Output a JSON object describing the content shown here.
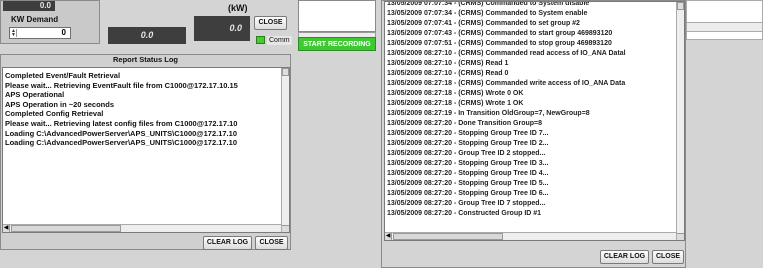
{
  "kw_panel": {
    "top_value": "0.0",
    "label": "KW Demand",
    "input_value": "0"
  },
  "power_panel": {
    "unit_label": "(kW)",
    "left_value": "0.0",
    "right_value": "0.0",
    "close_label": "CLOSE",
    "comm_label": "Comm"
  },
  "start_recording_label": "START RECORDING",
  "report_log": {
    "title": "Report Status Log",
    "lines": [
      "Completed Event/Fault Retrieval",
      "Please wait... Retrieving EventFault file from C1000@172.17.10.15",
      "APS Operational",
      "APS Operation in ~20 seconds",
      "Completed Config Retrieval",
      "Please wait... Retrieving latest config files from C1000@172.17.10",
      "Loading C:\\AdvancedPowerServer\\APS_UNITS\\C1000@172.17.10",
      "Loading C:\\AdvancedPowerServer\\APS_UNITS\\C1000@172.17.10"
    ],
    "clear_label": "CLEAR LOG",
    "close_label": "CLOSE"
  },
  "command_log": {
    "lines": [
      "13/05/2009 07:07:34 - (CRMS) Commanded to System disable",
      "13/05/2009 07:07:34 - (CRMS) Commanded to System enable",
      "13/05/2009 07:07:41 - (CRMS) Commanded to set group #2",
      "13/05/2009 07:07:43 - (CRMS) Commanded to start group 469893120",
      "13/05/2009 07:07:51 - (CRMS) Commanded to stop group 469893120",
      "13/05/2009 08:27:10 - (CRMS) Commanded read access of IO_ANA Datal",
      "13/05/2009 08:27:10 - (CRMS) Read 1",
      "13/05/2009 08:27:10 - (CRMS) Read 0",
      "13/05/2009 08:27:18 - (CRMS) Commanded write access of IO_ANA Data",
      "13/05/2009 08:27:18 - (CRMS) Wrote 0 OK",
      "13/05/2009 08:27:18 - (CRMS) Wrote 1 OK",
      "13/05/2009 08:27:19 - In Transition OldGroup=7, NewGroup=8",
      "13/05/2009 08:27:20 - Done Transition Group=8",
      "13/05/2009 08:27:20 - Stopping Group Tree ID 7...",
      "13/05/2009 08:27:20 - Stopping Group Tree ID 2...",
      "13/05/2009 08:27:20 - Group Tree ID 2 stopped...",
      "13/05/2009 08:27:20 - Stopping Group Tree ID 3...",
      "13/05/2009 08:27:20 - Stopping Group Tree ID 4...",
      "13/05/2009 08:27:20 - Stopping Group Tree ID 5...",
      "13/05/2009 08:27:20 - Stopping Group Tree ID 6...",
      "13/05/2009 08:27:20 - Group Tree ID 7 stopped...",
      "13/05/2009 08:27:20 - Constructed Group ID #1"
    ],
    "clear_label": "CLEAR LOG",
    "close_label": "CLOSE"
  },
  "colors": {
    "background": "#d4d4d4",
    "display_bg": "#3e3e3e",
    "start_recording": "#3ec932",
    "comm_led": "#46cc2e"
  }
}
